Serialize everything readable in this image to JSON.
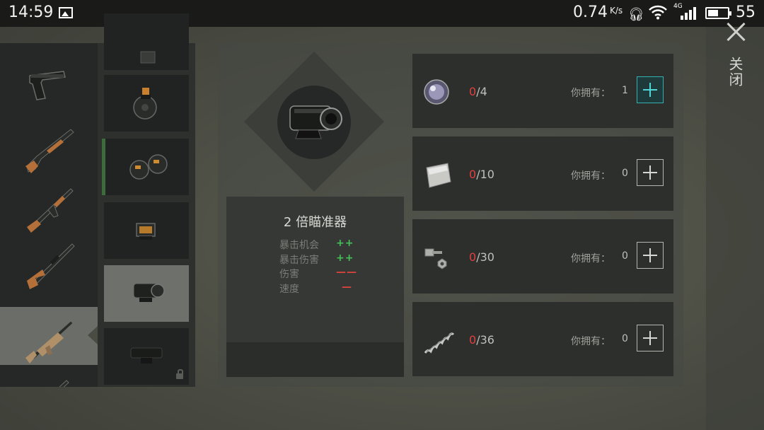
{
  "status_bar": {
    "time": "14:59",
    "net_speed": "0.74",
    "net_unit": "K/s",
    "network_type": "4G",
    "battery": "55"
  },
  "close": {
    "label": "关闭"
  },
  "weapons": [
    {
      "name": "pistol-icon"
    },
    {
      "name": "shotgun-icon"
    },
    {
      "name": "assault-rifle-icon"
    },
    {
      "name": "sniper-rifle-icon"
    },
    {
      "name": "scar-rifle-icon",
      "selected": true
    }
  ],
  "attachments": [
    {
      "name": "magazine-icon"
    },
    {
      "name": "drum-magazine-icon"
    },
    {
      "name": "double-magazine-icon",
      "equipped": true
    },
    {
      "name": "holo-sight-icon"
    },
    {
      "name": "scope-2x-icon",
      "selected": true
    },
    {
      "name": "long-scope-icon",
      "locked": true
    }
  ],
  "item": {
    "name": "2 倍瞄准器",
    "stats": [
      {
        "label": "暴击机会",
        "value": "++",
        "sign": "pos"
      },
      {
        "label": "暴击伤害",
        "value": "++",
        "sign": "pos"
      },
      {
        "label": "伤害",
        "value": "——",
        "sign": "neg"
      },
      {
        "label": "速度",
        "value": "—",
        "sign": "neg"
      }
    ]
  },
  "materials": [
    {
      "icon": "lens-icon",
      "have": "0",
      "need": "/4",
      "owned_label": "你拥有：",
      "owned": "1",
      "active": true
    },
    {
      "icon": "metal-plate-icon",
      "have": "0",
      "need": "/10",
      "owned_label": "你拥有：",
      "owned": "0"
    },
    {
      "icon": "bolt-nut-icon",
      "have": "0",
      "need": "/30",
      "owned_label": "你拥有：",
      "owned": "0"
    },
    {
      "icon": "spring-icon",
      "have": "0",
      "need": "/36",
      "owned_label": "你拥有：",
      "owned": "0"
    }
  ]
}
